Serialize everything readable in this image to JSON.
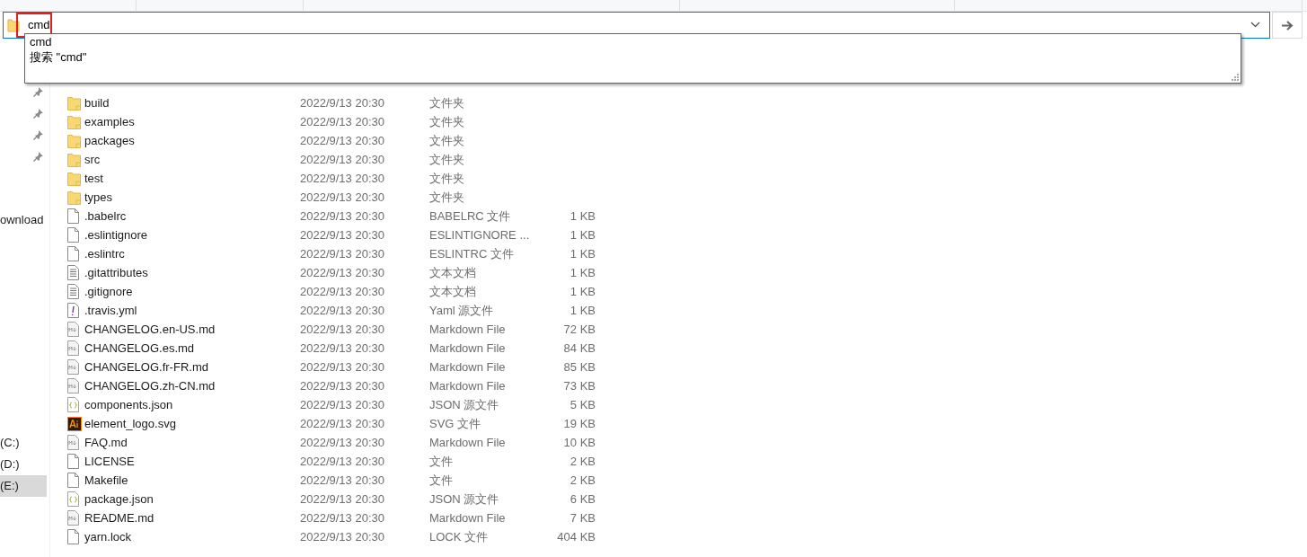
{
  "address_bar": {
    "value": "cmd",
    "highlighted": true
  },
  "autocomplete": {
    "items": [
      "cmd",
      "搜索 \"cmd\""
    ]
  },
  "sidebar": {
    "pins": [
      {
        "kind": "pin"
      },
      {
        "kind": "pin"
      },
      {
        "kind": "pin"
      },
      {
        "kind": "pin"
      }
    ],
    "items": [
      {
        "label": "ownload",
        "selected": false,
        "kind": "quick"
      },
      {
        "label": "(C:)",
        "selected": false,
        "kind": "drive"
      },
      {
        "label": "(D:)",
        "selected": false,
        "kind": "drive"
      },
      {
        "label": "(E:)",
        "selected": true,
        "kind": "drive"
      }
    ]
  },
  "files": [
    {
      "name": "build",
      "modified": "2022/9/13 20:30",
      "type": "文件夹",
      "kind": "folder"
    },
    {
      "name": "examples",
      "modified": "2022/9/13 20:30",
      "type": "文件夹",
      "kind": "folder"
    },
    {
      "name": "packages",
      "modified": "2022/9/13 20:30",
      "type": "文件夹",
      "kind": "folder"
    },
    {
      "name": "src",
      "modified": "2022/9/13 20:30",
      "type": "文件夹",
      "kind": "folder"
    },
    {
      "name": "test",
      "modified": "2022/9/13 20:30",
      "type": "文件夹",
      "kind": "folder"
    },
    {
      "name": "types",
      "modified": "2022/9/13 20:30",
      "type": "文件夹",
      "kind": "folder"
    },
    {
      "name": ".babelrc",
      "modified": "2022/9/13 20:30",
      "type": "BABELRC 文件",
      "size": "1 KB",
      "kind": "file"
    },
    {
      "name": ".eslintignore",
      "modified": "2022/9/13 20:30",
      "type": "ESLINTIGNORE ...",
      "size": "1 KB",
      "kind": "file"
    },
    {
      "name": ".eslintrc",
      "modified": "2022/9/13 20:30",
      "type": "ESLINTRC 文件",
      "size": "1 KB",
      "kind": "file"
    },
    {
      "name": ".gitattributes",
      "modified": "2022/9/13 20:30",
      "type": "文本文档",
      "size": "1 KB",
      "kind": "text"
    },
    {
      "name": ".gitignore",
      "modified": "2022/9/13 20:30",
      "type": "文本文档",
      "size": "1 KB",
      "kind": "text"
    },
    {
      "name": ".travis.yml",
      "modified": "2022/9/13 20:30",
      "type": "Yaml 源文件",
      "size": "1 KB",
      "kind": "yaml"
    },
    {
      "name": "CHANGELOG.en-US.md",
      "modified": "2022/9/13 20:30",
      "type": "Markdown File",
      "size": "72 KB",
      "kind": "markdown"
    },
    {
      "name": "CHANGELOG.es.md",
      "modified": "2022/9/13 20:30",
      "type": "Markdown File",
      "size": "84 KB",
      "kind": "markdown"
    },
    {
      "name": "CHANGELOG.fr-FR.md",
      "modified": "2022/9/13 20:30",
      "type": "Markdown File",
      "size": "85 KB",
      "kind": "markdown"
    },
    {
      "name": "CHANGELOG.zh-CN.md",
      "modified": "2022/9/13 20:30",
      "type": "Markdown File",
      "size": "73 KB",
      "kind": "markdown"
    },
    {
      "name": "components.json",
      "modified": "2022/9/13 20:30",
      "type": "JSON 源文件",
      "size": "5 KB",
      "kind": "json"
    },
    {
      "name": "element_logo.svg",
      "modified": "2022/9/13 20:30",
      "type": "SVG 文件",
      "size": "19 KB",
      "kind": "illustrator"
    },
    {
      "name": "FAQ.md",
      "modified": "2022/9/13 20:30",
      "type": "Markdown File",
      "size": "10 KB",
      "kind": "markdown"
    },
    {
      "name": "LICENSE",
      "modified": "2022/9/13 20:30",
      "type": "文件",
      "size": "2 KB",
      "kind": "file"
    },
    {
      "name": "Makefile",
      "modified": "2022/9/13 20:30",
      "type": "文件",
      "size": "2 KB",
      "kind": "file"
    },
    {
      "name": "package.json",
      "modified": "2022/9/13 20:30",
      "type": "JSON 源文件",
      "size": "6 KB",
      "kind": "json"
    },
    {
      "name": "README.md",
      "modified": "2022/9/13 20:30",
      "type": "Markdown File",
      "size": "7 KB",
      "kind": "markdown"
    },
    {
      "name": "yarn.lock",
      "modified": "2022/9/13 20:30",
      "type": "LOCK 文件",
      "size": "404 KB",
      "kind": "file"
    }
  ]
}
